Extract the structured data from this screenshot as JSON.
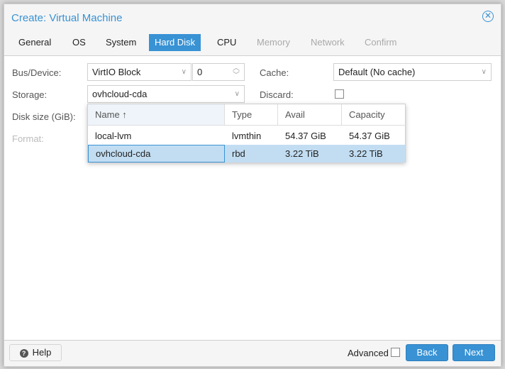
{
  "dialog": {
    "title": "Create: Virtual Machine",
    "close_icon": "close-circle-icon"
  },
  "tabs": [
    {
      "label": "General",
      "state": "normal"
    },
    {
      "label": "OS",
      "state": "normal"
    },
    {
      "label": "System",
      "state": "normal"
    },
    {
      "label": "Hard Disk",
      "state": "active"
    },
    {
      "label": "CPU",
      "state": "normal"
    },
    {
      "label": "Memory",
      "state": "disabled"
    },
    {
      "label": "Network",
      "state": "disabled"
    },
    {
      "label": "Confirm",
      "state": "disabled"
    }
  ],
  "form": {
    "bus_label": "Bus/Device:",
    "bus_value": "VirtIO Block",
    "device_value": "0",
    "storage_label": "Storage:",
    "storage_value": "ovhcloud-cda",
    "disk_size_label": "Disk size (GiB):",
    "format_label": "Format:",
    "cache_label": "Cache:",
    "cache_value": "Default (No cache)",
    "discard_label": "Discard:",
    "discard_checked": false
  },
  "storage_picker": {
    "columns": [
      "Name ↑",
      "Type",
      "Avail",
      "Capacity"
    ],
    "rows": [
      [
        "local-lvm",
        "lvmthin",
        "54.37 GiB",
        "54.37 GiB"
      ],
      [
        "ovhcloud-cda",
        "rbd",
        "3.22 TiB",
        "3.22 TiB"
      ]
    ],
    "selected": 1
  },
  "footer": {
    "help": "Help",
    "advanced": "Advanced",
    "back": "Back",
    "next": "Next"
  },
  "colors": {
    "accent": "#3892d4",
    "selected_row": "#c2ddf2"
  }
}
